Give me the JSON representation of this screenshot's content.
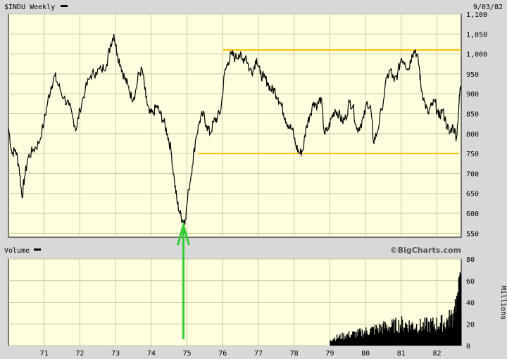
{
  "header": {
    "ticker_label": "$INDU Weekly",
    "date_label": "9/03/82"
  },
  "volume_header": {
    "label": "Volume"
  },
  "copyright": "©BigCharts.com",
  "colors": {
    "panel_bg": "#ffffe0",
    "frame_bg": "#d8d8d8",
    "grid": "#c8c8a8",
    "price_line": "#000000",
    "resistance_line": "#ffc000",
    "arrow": "#33cc33",
    "volume_bars": "#000000"
  },
  "chart_data": [
    {
      "type": "line",
      "title": "$INDU Weekly",
      "x_label": "",
      "y_label": "",
      "x_ticks": [
        "71",
        "72",
        "73",
        "74",
        "75",
        "76",
        "77",
        "78",
        "79",
        "80",
        "81",
        "82"
      ],
      "x_range": [
        1970.0,
        1982.68
      ],
      "y_ticks": [
        "550",
        "600",
        "650",
        "700",
        "750",
        "800",
        "850",
        "900",
        "950",
        "1,000",
        "1,050",
        "1,100"
      ],
      "ylim": [
        540,
        1100
      ],
      "grid": true,
      "series": [
        {
          "values": [
            [
              1970.0,
              815
            ],
            [
              1970.1,
              750
            ],
            [
              1970.2,
              760
            ],
            [
              1970.3,
              715
            ],
            [
              1970.38,
              640
            ],
            [
              1970.45,
              690
            ],
            [
              1970.55,
              740
            ],
            [
              1970.7,
              760
            ],
            [
              1970.85,
              775
            ],
            [
              1971.0,
              830
            ],
            [
              1971.1,
              880
            ],
            [
              1971.2,
              920
            ],
            [
              1971.3,
              945
            ],
            [
              1971.4,
              920
            ],
            [
              1971.55,
              890
            ],
            [
              1971.7,
              870
            ],
            [
              1971.8,
              840
            ],
            [
              1971.9,
              810
            ],
            [
              1972.0,
              860
            ],
            [
              1972.15,
              910
            ],
            [
              1972.3,
              945
            ],
            [
              1972.45,
              955
            ],
            [
              1972.6,
              960
            ],
            [
              1972.75,
              975
            ],
            [
              1972.85,
              1020
            ],
            [
              1972.95,
              1050
            ],
            [
              1973.05,
              1000
            ],
            [
              1973.15,
              970
            ],
            [
              1973.25,
              940
            ],
            [
              1973.35,
              920
            ],
            [
              1973.45,
              890
            ],
            [
              1973.55,
              900
            ],
            [
              1973.65,
              950
            ],
            [
              1973.75,
              960
            ],
            [
              1973.85,
              890
            ],
            [
              1973.95,
              850
            ],
            [
              1974.05,
              850
            ],
            [
              1974.15,
              870
            ],
            [
              1974.25,
              850
            ],
            [
              1974.35,
              830
            ],
            [
              1974.45,
              800
            ],
            [
              1974.55,
              760
            ],
            [
              1974.65,
              680
            ],
            [
              1974.72,
              630
            ],
            [
              1974.8,
              600
            ],
            [
              1974.9,
              580
            ],
            [
              1974.95,
              585
            ],
            [
              1975.05,
              660
            ],
            [
              1975.15,
              720
            ],
            [
              1975.25,
              790
            ],
            [
              1975.35,
              830
            ],
            [
              1975.45,
              850
            ],
            [
              1975.55,
              820
            ],
            [
              1975.65,
              800
            ],
            [
              1975.75,
              830
            ],
            [
              1975.85,
              840
            ],
            [
              1975.95,
              860
            ],
            [
              1976.05,
              950
            ],
            [
              1976.15,
              980
            ],
            [
              1976.25,
              1000
            ],
            [
              1976.35,
              990
            ],
            [
              1976.45,
              1000
            ],
            [
              1976.55,
              985
            ],
            [
              1976.65,
              995
            ],
            [
              1976.75,
              960
            ],
            [
              1976.85,
              960
            ],
            [
              1976.95,
              990
            ],
            [
              1977.05,
              950
            ],
            [
              1977.15,
              940
            ],
            [
              1977.25,
              930
            ],
            [
              1977.35,
              910
            ],
            [
              1977.45,
              910
            ],
            [
              1977.55,
              890
            ],
            [
              1977.65,
              870
            ],
            [
              1977.75,
              840
            ],
            [
              1977.85,
              820
            ],
            [
              1977.95,
              810
            ],
            [
              1978.05,
              770
            ],
            [
              1978.15,
              750
            ],
            [
              1978.25,
              760
            ],
            [
              1978.35,
              820
            ],
            [
              1978.45,
              850
            ],
            [
              1978.55,
              880
            ],
            [
              1978.65,
              870
            ],
            [
              1978.75,
              890
            ],
            [
              1978.85,
              800
            ],
            [
              1978.95,
              810
            ],
            [
              1979.05,
              840
            ],
            [
              1979.15,
              860
            ],
            [
              1979.25,
              850
            ],
            [
              1979.35,
              830
            ],
            [
              1979.45,
              840
            ],
            [
              1979.55,
              880
            ],
            [
              1979.65,
              870
            ],
            [
              1979.75,
              810
            ],
            [
              1979.85,
              820
            ],
            [
              1979.95,
              840
            ],
            [
              1980.05,
              880
            ],
            [
              1980.15,
              860
            ],
            [
              1980.22,
              780
            ],
            [
              1980.32,
              800
            ],
            [
              1980.45,
              860
            ],
            [
              1980.6,
              940
            ],
            [
              1980.7,
              960
            ],
            [
              1980.8,
              930
            ],
            [
              1980.9,
              950
            ],
            [
              1981.0,
              990
            ],
            [
              1981.1,
              980
            ],
            [
              1981.2,
              960
            ],
            [
              1981.3,
              1000
            ],
            [
              1981.4,
              1010
            ],
            [
              1981.5,
              970
            ],
            [
              1981.55,
              920
            ],
            [
              1981.65,
              880
            ],
            [
              1981.75,
              850
            ],
            [
              1981.85,
              870
            ],
            [
              1981.95,
              880
            ],
            [
              1982.05,
              840
            ],
            [
              1982.15,
              860
            ],
            [
              1982.25,
              830
            ],
            [
              1982.35,
              800
            ],
            [
              1982.45,
              820
            ],
            [
              1982.55,
              790
            ],
            [
              1982.62,
              880
            ],
            [
              1982.66,
              920
            ]
          ]
        }
      ],
      "reference_lines": [
        {
          "y": 1010,
          "x_start": 1976.0,
          "x_end": 1982.68
        },
        {
          "y": 750,
          "x_start": 1975.3,
          "x_end": 1982.62
        }
      ],
      "annotation": {
        "type": "arrow",
        "x": 1974.9,
        "y_price": 570
      }
    },
    {
      "type": "bar",
      "title": "Volume",
      "x_range": [
        1970.0,
        1982.68
      ],
      "y_label": "Millions",
      "y_ticks": [
        "0",
        "20",
        "40",
        "60",
        "80"
      ],
      "ylim": [
        0,
        80
      ],
      "grid": true,
      "series": [
        {
          "values": [
            [
              1979.0,
              6
            ],
            [
              1979.25,
              8
            ],
            [
              1979.5,
              10
            ],
            [
              1979.75,
              11
            ],
            [
              1980.0,
              13
            ],
            [
              1980.25,
              15
            ],
            [
              1980.5,
              17
            ],
            [
              1980.75,
              18
            ],
            [
              1981.0,
              20
            ],
            [
              1981.25,
              19
            ],
            [
              1981.5,
              18
            ],
            [
              1981.75,
              19
            ],
            [
              1982.0,
              20
            ],
            [
              1982.25,
              22
            ],
            [
              1982.45,
              28
            ],
            [
              1982.55,
              35
            ],
            [
              1982.62,
              55
            ],
            [
              1982.66,
              45
            ]
          ]
        }
      ]
    }
  ]
}
